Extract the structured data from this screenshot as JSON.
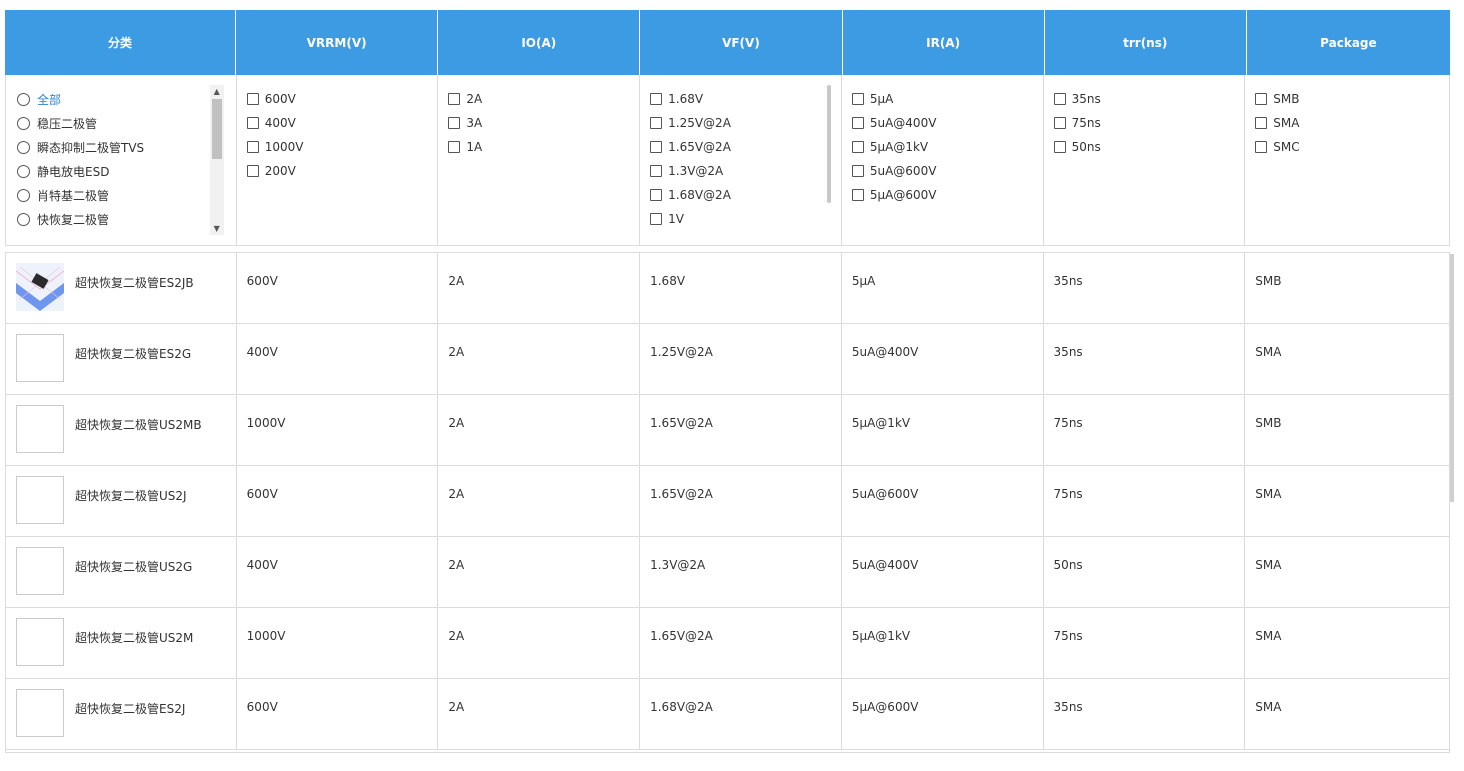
{
  "header": [
    "分类",
    "VRRM(V)",
    "IO(A)",
    "VF(V)",
    "IR(A)",
    "trr(ns)",
    "Package"
  ],
  "filters": {
    "category": [
      "全部",
      "稳压二极管",
      "瞬态抑制二极管TVS",
      "静电放电ESD",
      "肖特基二极管",
      "快恢复二极管"
    ],
    "vrrm": [
      "600V",
      "400V",
      "1000V",
      "200V"
    ],
    "io": [
      "2A",
      "3A",
      "1A"
    ],
    "vf": [
      "1.68V",
      "1.25V@2A",
      "1.65V@2A",
      "1.3V@2A",
      "1.68V@2A",
      "1V"
    ],
    "ir": [
      "5μA",
      "5uA@400V",
      "5μA@1kV",
      "5uA@600V",
      "5μA@600V"
    ],
    "trr": [
      "35ns",
      "75ns",
      "50ns"
    ],
    "package": [
      "SMB",
      "SMA",
      "SMC"
    ]
  },
  "products": [
    {
      "name": "超快恢复二极管ES2JB",
      "vrrm": "600V",
      "io": "2A",
      "vf": "1.68V",
      "ir": "5μA",
      "trr": "35ns",
      "pkg": "SMB"
    },
    {
      "name": "超快恢复二极管ES2G",
      "vrrm": "400V",
      "io": "2A",
      "vf": "1.25V@2A",
      "ir": "5uA@400V",
      "trr": "35ns",
      "pkg": "SMA"
    },
    {
      "name": "超快恢复二极管US2MB",
      "vrrm": "1000V",
      "io": "2A",
      "vf": "1.65V@2A",
      "ir": "5μA@1kV",
      "trr": "75ns",
      "pkg": "SMB"
    },
    {
      "name": "超快恢复二极管US2J",
      "vrrm": "600V",
      "io": "2A",
      "vf": "1.65V@2A",
      "ir": "5uA@600V",
      "trr": "75ns",
      "pkg": "SMA"
    },
    {
      "name": "超快恢复二极管US2G",
      "vrrm": "400V",
      "io": "2A",
      "vf": "1.3V@2A",
      "ir": "5uA@400V",
      "trr": "50ns",
      "pkg": "SMA"
    },
    {
      "name": "超快恢复二极管US2M",
      "vrrm": "1000V",
      "io": "2A",
      "vf": "1.65V@2A",
      "ir": "5μA@1kV",
      "trr": "75ns",
      "pkg": "SMA"
    },
    {
      "name": "超快恢复二极管ES2J",
      "vrrm": "600V",
      "io": "2A",
      "vf": "1.68V@2A",
      "ir": "5μA@600V",
      "trr": "35ns",
      "pkg": "SMA"
    }
  ],
  "colors": {
    "header_bg": "#3d9be4",
    "active_link": "#2b83d3",
    "border": "#dcdcdc"
  }
}
